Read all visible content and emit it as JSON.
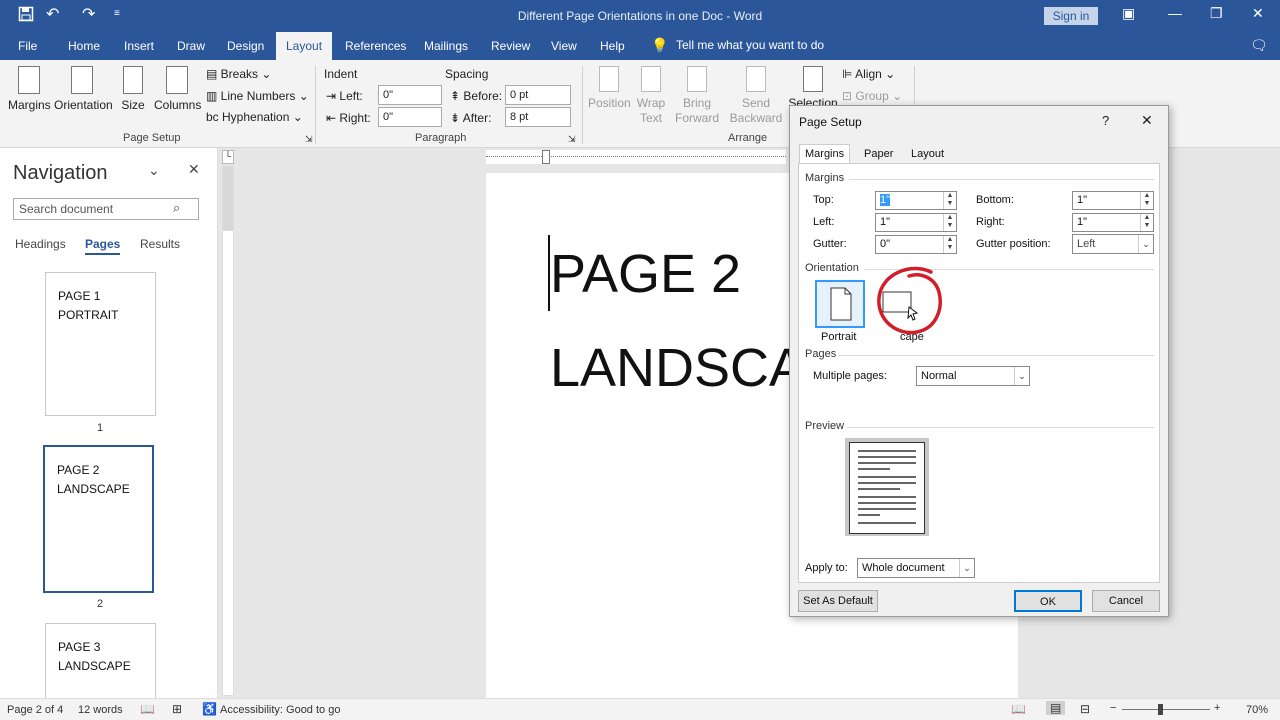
{
  "titlebar": {
    "title": "Different Page Orientations in one Doc - Word",
    "signin": "Sign in",
    "qa_icons": [
      "save-icon",
      "undo-icon",
      "redo-icon",
      "customize-icon"
    ],
    "window_icons": [
      "ribbon-display-icon",
      "minimize-icon",
      "restore-icon",
      "close-icon"
    ]
  },
  "tabs": [
    "File",
    "Home",
    "Insert",
    "Draw",
    "Design",
    "Layout",
    "References",
    "Mailings",
    "Review",
    "View",
    "Help"
  ],
  "active_tab": "Layout",
  "tell_me": "Tell me what you want to do",
  "ribbon": {
    "page_setup": {
      "buttons": [
        "Margins",
        "Orientation",
        "Size",
        "Columns"
      ],
      "small": [
        "Breaks",
        "Line Numbers",
        "Hyphenation"
      ],
      "label": "Page Setup"
    },
    "paragraph": {
      "indent_label": "Indent",
      "spacing_label": "Spacing",
      "left_label": "Left:",
      "left_value": "0\"",
      "right_label": "Right:",
      "right_value": "0\"",
      "before_label": "Before:",
      "before_value": "0 pt",
      "after_label": "After:",
      "after_value": "8 pt",
      "label": "Paragraph"
    },
    "arrange": {
      "buttons": [
        "Position",
        "Wrap Text",
        "Bring Forward",
        "Send Backward",
        "Selection"
      ],
      "small": [
        "Align",
        "Group"
      ],
      "label": "Arrange"
    }
  },
  "navigation": {
    "title": "Navigation",
    "search_placeholder": "Search document",
    "tabs": [
      "Headings",
      "Pages",
      "Results"
    ],
    "active_tab": "Pages",
    "pages": [
      {
        "line1": "PAGE 1",
        "line2": "PORTRAIT",
        "num": "1"
      },
      {
        "line1": "PAGE 2",
        "line2": "LANDSCAPE",
        "num": "2"
      },
      {
        "line1": "PAGE 3",
        "line2": "LANDSCAPE",
        "num": ""
      }
    ]
  },
  "document": {
    "line1": "PAGE 2",
    "line2": "LANDSCA"
  },
  "dialog": {
    "title": "Page Setup",
    "help": "?",
    "close": "✕",
    "tabs": [
      "Margins",
      "Paper",
      "Layout"
    ],
    "active_tab": "Margins",
    "margins_section": "Margins",
    "top_label": "Top:",
    "top_value": "1\"",
    "bottom_label": "Bottom:",
    "bottom_value": "1\"",
    "left_label": "Left:",
    "left_value": "1\"",
    "right_label": "Right:",
    "right_value": "1\"",
    "gutter_label": "Gutter:",
    "gutter_value": "0\"",
    "gutter_pos_label": "Gutter position:",
    "gutter_pos_value": "Left",
    "orientation_section": "Orientation",
    "portrait": "Portrait",
    "landscape_partial": "cape",
    "pages_section": "Pages",
    "multiple_pages_label": "Multiple pages:",
    "multiple_pages_value": "Normal",
    "preview_section": "Preview",
    "apply_to_label": "Apply to:",
    "apply_to_value": "Whole document",
    "set_default": "Set As Default",
    "ok": "OK",
    "cancel": "Cancel",
    "annotation_color": "#d11f2a"
  },
  "status": {
    "page": "Page 2 of 4",
    "words": "12 words",
    "accessibility": "Accessibility: Good to go",
    "zoom": "70%"
  },
  "colors": {
    "brand": "#2b579a"
  }
}
